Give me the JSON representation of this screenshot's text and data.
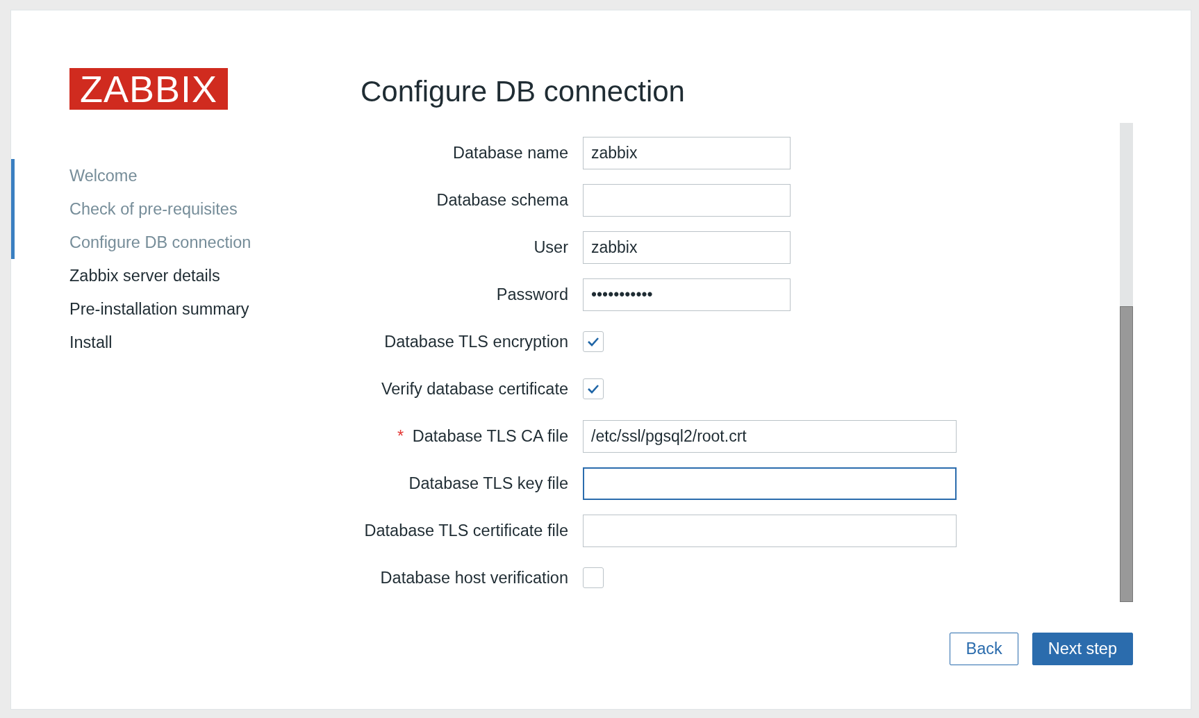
{
  "logo": "ZABBIX",
  "steps": [
    {
      "label": "Welcome",
      "done": true
    },
    {
      "label": "Check of pre-requisites",
      "done": true
    },
    {
      "label": "Configure DB connection",
      "done": true
    },
    {
      "label": "Zabbix server details",
      "done": false
    },
    {
      "label": "Pre-installation summary",
      "done": false
    },
    {
      "label": "Install",
      "done": false
    }
  ],
  "title": "Configure DB connection",
  "fields": [
    {
      "kind": "text",
      "label": "Database name",
      "value": "zabbix",
      "focused": false
    },
    {
      "kind": "text",
      "label": "Database schema",
      "focused": false
    },
    {
      "kind": "text",
      "label": "User",
      "value": "zabbix",
      "focused": false
    },
    {
      "kind": "text",
      "label": "Password",
      "value": "•••••••••••",
      "focused": false
    },
    {
      "kind": "checkbox",
      "label": "Database TLS encryption",
      "checked": true
    },
    {
      "kind": "checkbox",
      "label": "Verify database certificate",
      "checked": true
    },
    {
      "kind": "path",
      "label": "Database TLS CA file",
      "marker": "*",
      "value": "/etc/ssl/pgsql2/root.crt",
      "focused": false
    },
    {
      "kind": "path",
      "label": "Database TLS key file",
      "focused": true
    },
    {
      "kind": "path",
      "label": "Database TLS certificate file",
      "focused": false
    },
    {
      "kind": "checkbox",
      "label": "Database host verification",
      "checked": false
    }
  ],
  "buttons": [
    {
      "label": "Back",
      "kind": "secondary"
    },
    {
      "label": "Next step",
      "kind": "primary"
    }
  ]
}
